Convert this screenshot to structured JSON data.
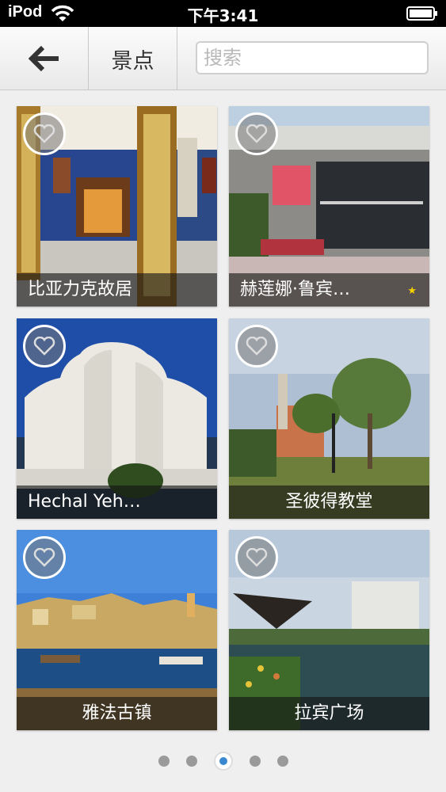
{
  "status_bar": {
    "carrier": "iPod",
    "time": "下午3:41",
    "wifi_icon": "wifi-icon",
    "battery_icon": "battery-icon"
  },
  "header": {
    "back_icon": "arrow-left-icon",
    "title": "景点",
    "search_placeholder": "搜索"
  },
  "attractions": [
    {
      "name": "比亚力克故居",
      "favorite": false
    },
    {
      "name": "赫莲娜·鲁宾…",
      "favorite": false,
      "star": "★"
    },
    {
      "name": "Hechal Yeh…",
      "favorite": false
    },
    {
      "name": "圣彼得教堂",
      "favorite": false
    },
    {
      "name": "雅法古镇",
      "favorite": false
    },
    {
      "name": "拉宾广场",
      "favorite": false
    }
  ],
  "pager": {
    "pages": 5,
    "current": 3
  },
  "colors": {
    "accent": "#3a89d0",
    "star": "#f6d100"
  }
}
